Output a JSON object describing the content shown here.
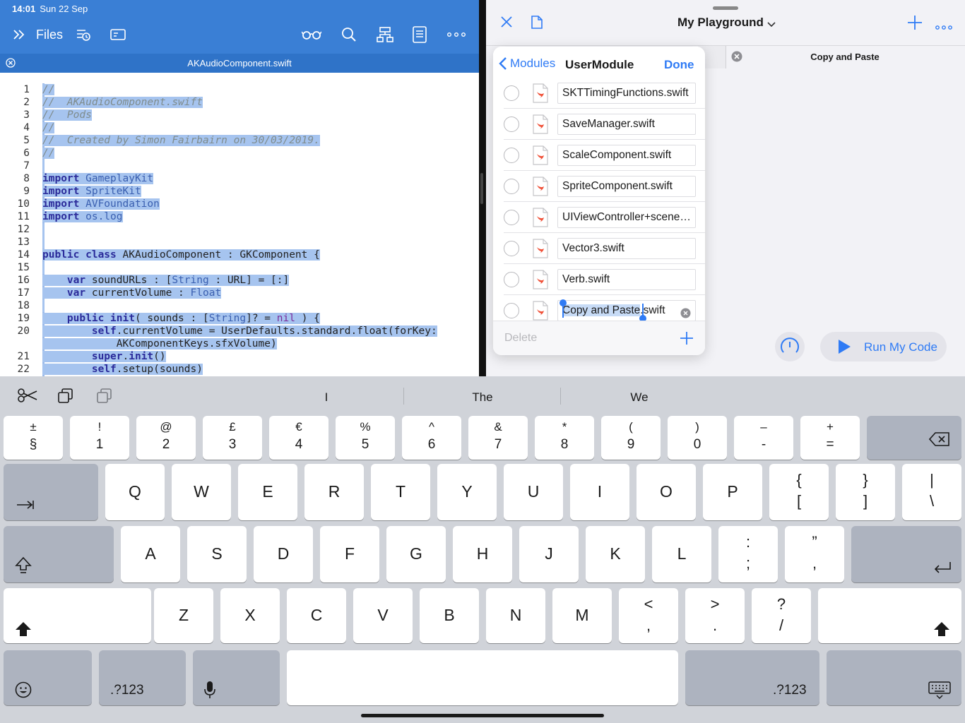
{
  "status_bar": {
    "time": "14:01",
    "date": "Sun 22 Sep"
  },
  "editor": {
    "files_label": "Files",
    "tab_title": "AKAudioComponent.swift",
    "lines": [
      {
        "n": "1",
        "tokens": [
          [
            "c-com",
            "//"
          ]
        ]
      },
      {
        "n": "2",
        "tokens": [
          [
            "c-com",
            "//  AKAudioComponent.swift"
          ]
        ]
      },
      {
        "n": "3",
        "tokens": [
          [
            "c-com",
            "//  Pods"
          ]
        ]
      },
      {
        "n": "4",
        "tokens": [
          [
            "c-com",
            "//"
          ]
        ]
      },
      {
        "n": "5",
        "tokens": [
          [
            "c-com",
            "//  Created by Simon Fairbairn on 30/03/2019."
          ]
        ]
      },
      {
        "n": "6",
        "tokens": [
          [
            "c-com",
            "//"
          ]
        ]
      },
      {
        "n": "7",
        "tokens": []
      },
      {
        "n": "8",
        "tokens": [
          [
            "c-kw",
            "import "
          ],
          [
            "c-ty",
            "GameplayKit"
          ]
        ]
      },
      {
        "n": "9",
        "tokens": [
          [
            "c-kw",
            "import "
          ],
          [
            "c-ty",
            "SpriteKit"
          ]
        ]
      },
      {
        "n": "10",
        "tokens": [
          [
            "c-kw",
            "import "
          ],
          [
            "c-ty",
            "AVFoundation"
          ]
        ]
      },
      {
        "n": "11",
        "tokens": [
          [
            "c-kw",
            "import "
          ],
          [
            "c-ty",
            "os.log"
          ]
        ]
      },
      {
        "n": "12",
        "tokens": []
      },
      {
        "n": "13",
        "tokens": []
      },
      {
        "n": "14",
        "tokens": [
          [
            "c-kw",
            "public class "
          ],
          [
            "c-id",
            "AKAudioComponent : GKComponent {"
          ]
        ]
      },
      {
        "n": "15",
        "tokens": []
      },
      {
        "n": "16",
        "tokens": [
          [
            "c-id",
            "    "
          ],
          [
            "c-kw",
            "var "
          ],
          [
            "c-id",
            "soundURLs : ["
          ],
          [
            "c-ty",
            "String"
          ],
          [
            "c-id",
            " : URL] = [:]"
          ]
        ]
      },
      {
        "n": "17",
        "tokens": [
          [
            "c-id",
            "    "
          ],
          [
            "c-kw",
            "var "
          ],
          [
            "c-id",
            "currentVolume : "
          ],
          [
            "c-ty",
            "Float"
          ]
        ]
      },
      {
        "n": "18",
        "tokens": []
      },
      {
        "n": "19",
        "tokens": [
          [
            "c-id",
            "    "
          ],
          [
            "c-kw",
            "public init"
          ],
          [
            "c-id",
            "( sounds : ["
          ],
          [
            "c-ty",
            "String"
          ],
          [
            "c-id",
            "]? = "
          ],
          [
            "c-lit",
            "nil"
          ],
          [
            "c-id",
            " ) {"
          ]
        ]
      },
      {
        "n": "20",
        "tokens": [
          [
            "c-id",
            "        "
          ],
          [
            "c-kw",
            "self"
          ],
          [
            "c-id",
            ".currentVolume = UserDefaults.standard.float(forKey:"
          ]
        ],
        "wrap": "            AKComponentKeys.sfxVolume)"
      },
      {
        "n": "21",
        "tokens": [
          [
            "c-id",
            "        "
          ],
          [
            "c-kw",
            "super"
          ],
          [
            "c-id",
            "."
          ],
          [
            "c-kw",
            "init"
          ],
          [
            "c-id",
            "()"
          ]
        ]
      },
      {
        "n": "22",
        "tokens": [
          [
            "c-id",
            "        "
          ],
          [
            "c-kw",
            "self"
          ],
          [
            "c-id",
            ".setup(sounds)"
          ]
        ]
      }
    ]
  },
  "playground": {
    "title": "My Playground",
    "tab_title": "Copy and Paste",
    "run_label": "Run My Code"
  },
  "modules_popover": {
    "back_label": "Modules",
    "title": "UserModule",
    "done_label": "Done",
    "delete_label": "Delete",
    "files": [
      "SKTTimingFunctions.swift",
      "SaveManager.swift",
      "ScaleComponent.swift",
      "SpriteComponent.swift",
      "UIViewController+scene.swift",
      "Vector3.swift",
      "Verb.swift"
    ],
    "editing_file": {
      "selected": "Copy and Paste",
      "rest": ".swift"
    }
  },
  "keyboard": {
    "suggestions": [
      "I",
      "The",
      "We"
    ],
    "number_row": [
      [
        "±",
        "§"
      ],
      [
        "!",
        "1"
      ],
      [
        "@",
        "2"
      ],
      [
        "£",
        "3"
      ],
      [
        "€",
        "4"
      ],
      [
        "%",
        "5"
      ],
      [
        "^",
        "6"
      ],
      [
        "&",
        "7"
      ],
      [
        "*",
        "8"
      ],
      [
        "(",
        "9"
      ],
      [
        ")",
        "0"
      ],
      [
        "–",
        "-"
      ],
      [
        "+",
        "="
      ]
    ],
    "row_q": [
      "Q",
      "W",
      "E",
      "R",
      "T",
      "Y",
      "U",
      "I",
      "O",
      "P"
    ],
    "row_q_extra": [
      [
        "{",
        "["
      ],
      [
        "}",
        "]"
      ],
      [
        "|",
        "\\"
      ]
    ],
    "row_a": [
      "A",
      "S",
      "D",
      "F",
      "G",
      "H",
      "J",
      "K",
      "L"
    ],
    "row_a_extra": [
      [
        ":",
        ";"
      ],
      [
        "”",
        ","
      ]
    ],
    "row_z_tilde": [
      "~",
      "`"
    ],
    "row_z": [
      "Z",
      "X",
      "C",
      "V",
      "B",
      "N",
      "M"
    ],
    "row_z_extra": [
      [
        "<",
        ","
      ],
      [
        ">",
        "."
      ],
      [
        "?",
        "/"
      ]
    ],
    "num_switch_label": ".?123"
  },
  "colors": {
    "editor_header": "#3a7fd5",
    "selection": "#a6c4ef",
    "accent": "#2f7bf5",
    "keyboard_bg": "#d0d3d9"
  }
}
